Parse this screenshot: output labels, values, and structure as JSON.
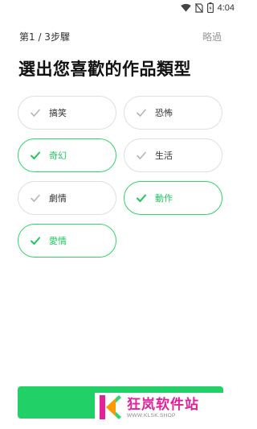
{
  "status_bar": {
    "time": "4:04"
  },
  "header": {
    "step": "第1 / 3步驟",
    "skip": "略過"
  },
  "title": "選出您喜歡的作品類型",
  "genres": [
    {
      "label": "搞笑",
      "selected": false
    },
    {
      "label": "恐怖",
      "selected": false
    },
    {
      "label": "奇幻",
      "selected": true
    },
    {
      "label": "生活",
      "selected": false
    },
    {
      "label": "劇情",
      "selected": false
    },
    {
      "label": "動作",
      "selected": true
    },
    {
      "label": "愛情",
      "selected": true
    }
  ],
  "colors": {
    "accent": "#22d068",
    "selected_text": "#1ec85c",
    "unselected_border": "#dfdfdf",
    "watermark": "#e0219a"
  },
  "watermark": {
    "text": "狂岚软件站",
    "url": "WWW.KLSK.SHOP"
  },
  "icons": {
    "check": "check-icon",
    "wifi": "wifi-icon",
    "no-sim": "no-sim-icon",
    "battery": "battery-icon"
  }
}
